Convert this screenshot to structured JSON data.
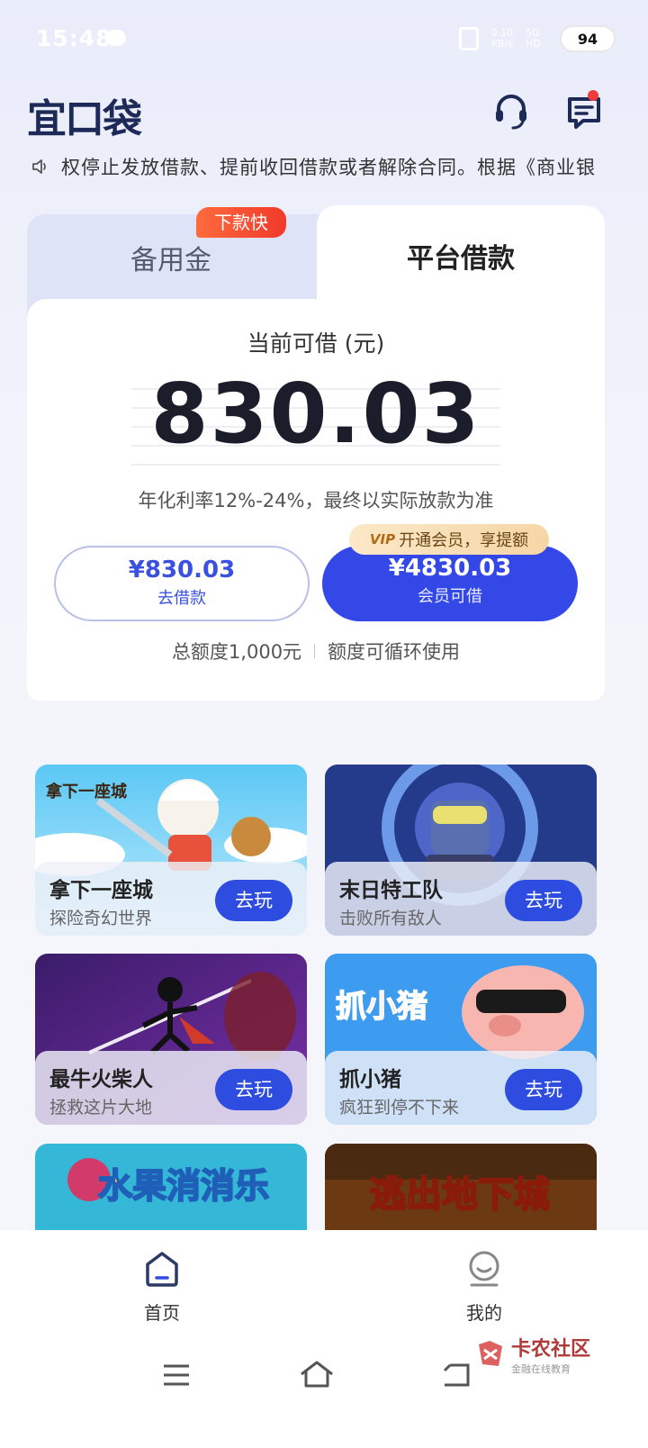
{
  "status_bar": {
    "time": "15:48",
    "net_speed": "0.10 KB/s",
    "signal": "5G HD",
    "battery": "94"
  },
  "header": {
    "logo": "宜口袋"
  },
  "notice": {
    "text": "权停止发放借款、提前收回借款或者解除合同。根据《商业银"
  },
  "loan_card": {
    "tab_backup": "备用金",
    "tab_platform": "平台借款",
    "fast_badge": "下款快",
    "available_label": "当前可借 (元)",
    "available_amount": "830.03",
    "rate_text": "年化利率12%-24%，最终以实际放款为准",
    "borrow_amount": "¥830.03",
    "borrow_label": "去借款",
    "member_amount": "¥4830.03",
    "member_label": "会员可借",
    "vip_tag": "VIP",
    "vip_text": "开通会员，享提额",
    "total_limit": "总额度1,000元",
    "cycle_text": "额度可循环使用"
  },
  "games": [
    {
      "title": "拿下一座城",
      "subtitle": "探险奇幻世界",
      "button": "去玩",
      "art_text": "拿下一座城"
    },
    {
      "title": "末日特工队",
      "subtitle": "击败所有敌人",
      "button": "去玩",
      "art_text": ""
    },
    {
      "title": "最牛火柴人",
      "subtitle": "拯救这片大地",
      "button": "去玩",
      "art_text": ""
    },
    {
      "title": "抓小猪",
      "subtitle": "疯狂到停不下来",
      "button": "去玩",
      "art_text": "抓小猪"
    },
    {
      "art_text": "水果消消乐"
    },
    {
      "art_text": "逃出地下城"
    }
  ],
  "bottom_nav": {
    "home": "首页",
    "me": "我的"
  },
  "watermark": {
    "title": "卡农社区",
    "sub": "金融在线教育"
  },
  "colors": {
    "primary": "#3348e6",
    "badge_red": "#f03a2a",
    "vip_gold": "#f5d6a6"
  }
}
